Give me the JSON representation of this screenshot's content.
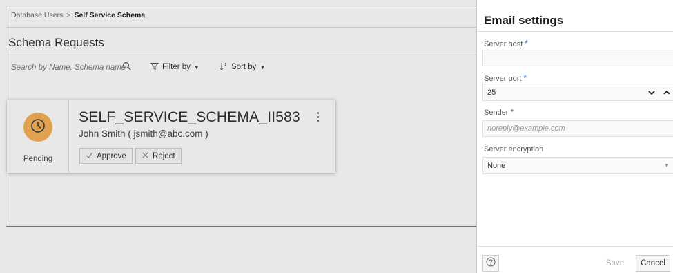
{
  "breadcrumb": {
    "parent": "Database Users",
    "separator": ">",
    "current": "Self Service Schema"
  },
  "page": {
    "title": "Schema Requests"
  },
  "toolbar": {
    "search_placeholder": "Search by Name, Schema name",
    "filter_label": "Filter by",
    "sort_label": "Sort by",
    "caret": "▼"
  },
  "request": {
    "schema_name": "SELF_SERVICE_SCHEMA_II583",
    "requester": "John Smith ( jsmith@abc.com )",
    "status": "Pending",
    "status_color": "#f7b25a",
    "approve_label": "Approve",
    "reject_label": "Reject"
  },
  "drawer": {
    "title": "Email settings",
    "required_mark": "*",
    "fields": {
      "server_host": {
        "label": "Server host",
        "value": ""
      },
      "server_port": {
        "label": "Server port",
        "value": "25"
      },
      "sender": {
        "label": "Sender",
        "placeholder": "noreply@example.com"
      },
      "server_encryption": {
        "label": "Server encryption",
        "value": "None",
        "caret": "▼"
      }
    },
    "footer": {
      "save_label": "Save",
      "cancel_label": "Cancel"
    }
  },
  "icons": {
    "search": "search-icon",
    "filter": "filter-icon",
    "sort": "sort-icon",
    "clock": "clock-icon",
    "approve": "check-icon",
    "reject": "close-icon",
    "more": "kebab-icon",
    "stepper_down": "chevron-down-icon",
    "stepper_up": "chevron-up-icon",
    "help": "help-icon"
  },
  "colors": {
    "accent_required": "#2f78c4",
    "pending": "#f7b25a"
  }
}
